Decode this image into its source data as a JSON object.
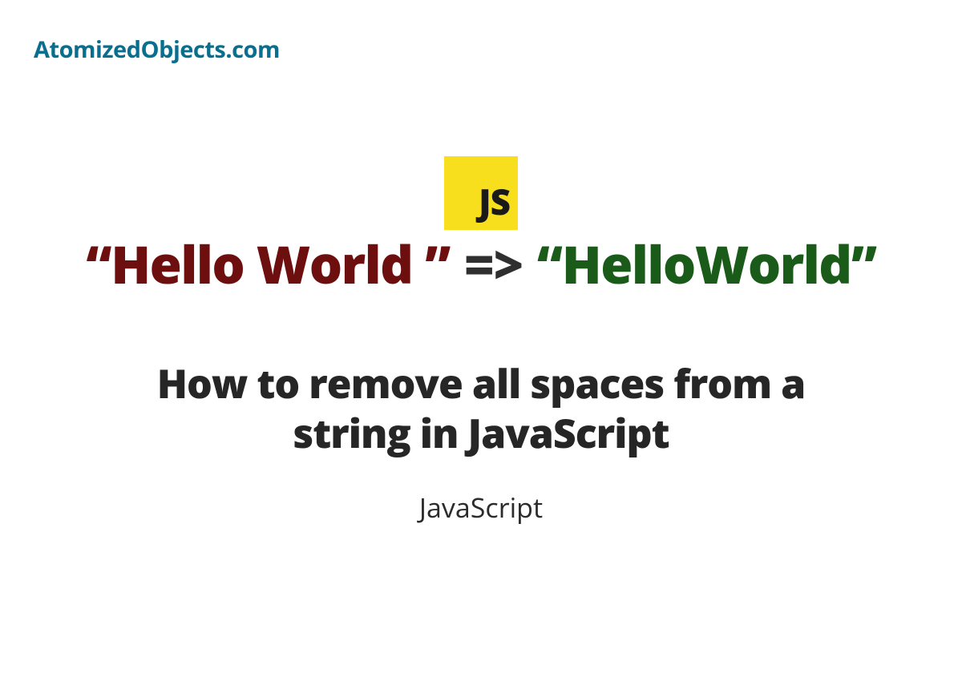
{
  "header": {
    "site_name": "AtomizedObjects.com"
  },
  "badge": {
    "label": "JS"
  },
  "transform": {
    "input": "“Hello World ”",
    "arrow": "=>",
    "output": "“HelloWorld”"
  },
  "main": {
    "title": "How to remove all spaces from a string in JavaScript",
    "category": "JavaScript"
  }
}
